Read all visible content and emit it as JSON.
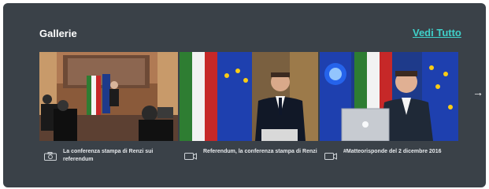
{
  "section": {
    "title": "Gallerie",
    "see_all_label": "Vedi Tutto"
  },
  "galleries": [
    {
      "caption": "La conferenza stampa di Renzi sui referendum",
      "icon": "photo-camera-icon"
    },
    {
      "caption": "Referendum, la conferenza stampa di Renzi",
      "icon": "video-camera-icon"
    },
    {
      "caption": "#Matteorisponde del 2 dicembre 2016",
      "icon": "video-camera-icon"
    }
  ],
  "navigation": {
    "next_glyph": "→"
  },
  "colors": {
    "panel_bg": "#3a4148",
    "accent": "#3fd0c9",
    "text": "#ffffff",
    "caption_text": "#e6e9ec"
  }
}
